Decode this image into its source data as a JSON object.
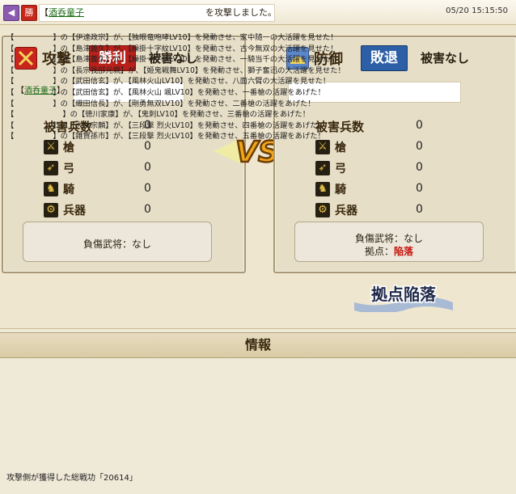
{
  "topbar": {
    "back_icon": "back-arrow-icon",
    "badge": "勝",
    "message_prefix": "【",
    "message_player": "酒呑童子",
    "message_suffix": "を攻撃しました。",
    "timestamp": "05/20 15:15:50"
  },
  "attack": {
    "title": "攻撃",
    "result": "勝利",
    "damage": "被害なし",
    "name_prefix": "【",
    "name_player": "酒呑童子",
    "name_suffix": "】",
    "stats_label": "被害兵数",
    "stats_value": "0",
    "units": [
      {
        "icon": "spear-icon",
        "label": "槍",
        "value": "0"
      },
      {
        "icon": "bow-icon",
        "label": "弓",
        "value": "0"
      },
      {
        "icon": "horse-icon",
        "label": "騎",
        "value": "0"
      },
      {
        "icon": "weapon-icon",
        "label": "兵器",
        "value": "0"
      }
    ],
    "injured": "負傷武将：なし"
  },
  "defense": {
    "title": "防御",
    "result": "敗退",
    "damage": "被害なし",
    "stats_label": "被害兵数",
    "stats_value": "0",
    "units": [
      {
        "icon": "spear-icon",
        "label": "槍",
        "value": "0"
      },
      {
        "icon": "bow-icon",
        "label": "弓",
        "value": "0"
      },
      {
        "icon": "horse-icon",
        "label": "騎",
        "value": "0"
      },
      {
        "icon": "weapon-icon",
        "label": "兵器",
        "value": "0"
      }
    ],
    "injured": "負傷武将：なし",
    "base_label": "拠点：",
    "base_status": "陥落"
  },
  "vs_text": "VS",
  "fallen_banner": "拠点陥落",
  "info": {
    "title": "情報",
    "lines": [
      "】の【伊達政宗】が、【独眼竜咆哮LV10】を発動させ、家中随一の大活躍を見せた！",
      "】の【島津義久】が、【繰掛十字紋LV10】を発動させ、古今無双の大活躍を見せた！",
      "】の【島津義久】が、【繰掛十字紋LV10】を発動させ、一騎当千の大活躍を見せた！",
      "】の【長宗我部元親】が、【姫鬼戦舞LV10】を発動させ、獅子奮迅の大活躍を見せた！",
      "】の【武田信玄】が、【風林火山LV10】を発動させ、八面六臂の大活躍を見せた！",
      "】の【武田信玄】が、【風林火山 颯LV10】を発動させ、一番槍の活躍をあげた！",
      "】の【織田信長】が、【剛勇無双LV10】を発動させ、二番槍の活躍をあげた！",
      "】の【徳川家康】が、【鬼刺LV10】を発動させ、三番槍の活躍をあげた！",
      "】の【大友宗麟】が、【三段撃 烈火LV10】を発動させ、四番槍の活躍をあげた！",
      "】の【雑賀孫市】が、【三段撃 烈火LV10】を発動させ、五番槍の活躍をあげた！"
    ],
    "total": "攻撃側が獲得した総戦功「20614」"
  }
}
